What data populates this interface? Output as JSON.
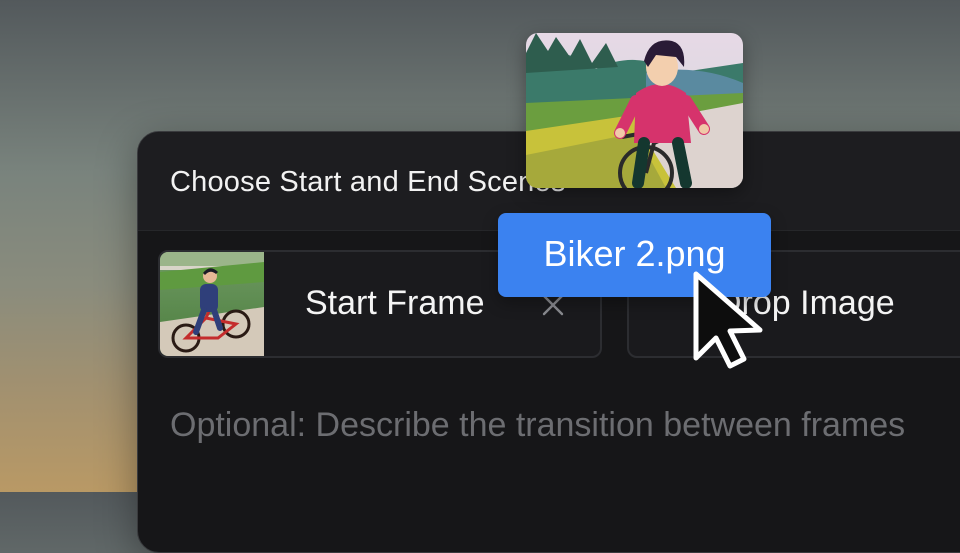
{
  "panel": {
    "title": "Choose Start and End Scenes"
  },
  "start_frame": {
    "label": "Start Frame",
    "thumbnail": "biker-thumbnail"
  },
  "end_frame": {
    "label": "Drop Image"
  },
  "prompt": {
    "placeholder": "Optional: Describe the transition between frames"
  },
  "drag": {
    "filename": "Biker 2.png"
  },
  "colors": {
    "accent": "#3b82f0",
    "panel_bg": "#161618",
    "text_primary": "#f4f4f4",
    "text_placeholder": "#6c6d71"
  }
}
